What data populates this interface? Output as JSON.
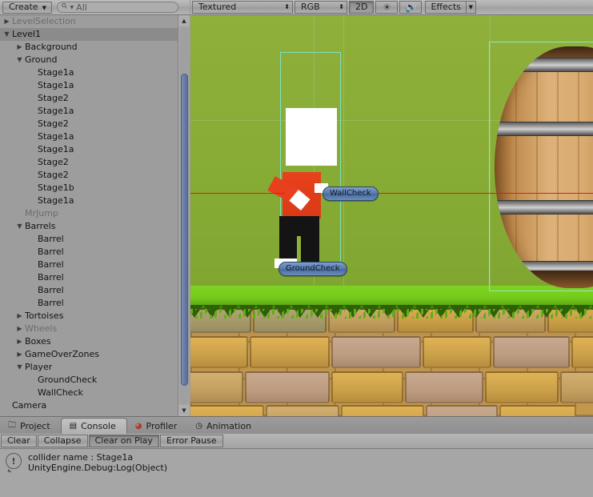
{
  "hierarchy": {
    "toolbar": {
      "create_label": "Create",
      "create_caret": "▼",
      "search_caret": "▼",
      "search_value": "All",
      "search_placeholder": "All"
    },
    "items": [
      {
        "label": "LevelSelection",
        "depth": 0,
        "arrow": "right",
        "active": false,
        "selected": false
      },
      {
        "label": "Level1",
        "depth": 0,
        "arrow": "down",
        "active": true,
        "selected": true
      },
      {
        "label": "Background",
        "depth": 1,
        "arrow": "right",
        "active": true,
        "selected": false
      },
      {
        "label": "Ground",
        "depth": 1,
        "arrow": "down",
        "active": true,
        "selected": false
      },
      {
        "label": "Stage1a",
        "depth": 2,
        "arrow": "none",
        "active": true,
        "selected": false
      },
      {
        "label": "Stage1a",
        "depth": 2,
        "arrow": "none",
        "active": true,
        "selected": false
      },
      {
        "label": "Stage2",
        "depth": 2,
        "arrow": "none",
        "active": true,
        "selected": false
      },
      {
        "label": "Stage1a",
        "depth": 2,
        "arrow": "none",
        "active": true,
        "selected": false
      },
      {
        "label": "Stage2",
        "depth": 2,
        "arrow": "none",
        "active": true,
        "selected": false
      },
      {
        "label": "Stage1a",
        "depth": 2,
        "arrow": "none",
        "active": true,
        "selected": false
      },
      {
        "label": "Stage1a",
        "depth": 2,
        "arrow": "none",
        "active": true,
        "selected": false
      },
      {
        "label": "Stage2",
        "depth": 2,
        "arrow": "none",
        "active": true,
        "selected": false
      },
      {
        "label": "Stage2",
        "depth": 2,
        "arrow": "none",
        "active": true,
        "selected": false
      },
      {
        "label": "Stage1b",
        "depth": 2,
        "arrow": "none",
        "active": true,
        "selected": false
      },
      {
        "label": "Stage1a",
        "depth": 2,
        "arrow": "none",
        "active": true,
        "selected": false
      },
      {
        "label": "MrJump",
        "depth": 1,
        "arrow": "none",
        "active": false,
        "selected": false
      },
      {
        "label": "Barrels",
        "depth": 1,
        "arrow": "down",
        "active": true,
        "selected": false
      },
      {
        "label": "Barrel",
        "depth": 2,
        "arrow": "none",
        "active": true,
        "selected": false
      },
      {
        "label": "Barrel",
        "depth": 2,
        "arrow": "none",
        "active": true,
        "selected": false
      },
      {
        "label": "Barrel",
        "depth": 2,
        "arrow": "none",
        "active": true,
        "selected": false
      },
      {
        "label": "Barrel",
        "depth": 2,
        "arrow": "none",
        "active": true,
        "selected": false
      },
      {
        "label": "Barrel",
        "depth": 2,
        "arrow": "none",
        "active": true,
        "selected": false
      },
      {
        "label": "Barrel",
        "depth": 2,
        "arrow": "none",
        "active": true,
        "selected": false
      },
      {
        "label": "Tortoises",
        "depth": 1,
        "arrow": "right",
        "active": true,
        "selected": false
      },
      {
        "label": "Wheels",
        "depth": 1,
        "arrow": "right",
        "active": false,
        "selected": false
      },
      {
        "label": "Boxes",
        "depth": 1,
        "arrow": "right",
        "active": true,
        "selected": false
      },
      {
        "label": "GameOverZones",
        "depth": 1,
        "arrow": "right",
        "active": true,
        "selected": false
      },
      {
        "label": "Player",
        "depth": 1,
        "arrow": "down",
        "active": true,
        "selected": false
      },
      {
        "label": "GroundCheck",
        "depth": 2,
        "arrow": "none",
        "active": true,
        "selected": false
      },
      {
        "label": "WallCheck",
        "depth": 2,
        "arrow": "none",
        "active": true,
        "selected": false
      },
      {
        "label": "Camera",
        "depth": 0,
        "arrow": "none",
        "active": true,
        "selected": false
      }
    ],
    "scrollbar": {
      "up_arrow": "▲",
      "down_arrow": "▼"
    }
  },
  "scene": {
    "toolbar": {
      "draw_mode": "Textured",
      "draw_mode_caret": "⬍",
      "color_mode": "RGB",
      "color_mode_caret": "⬍",
      "two_d_label": "2D",
      "lighting_icon": "light-icon",
      "audio_icon": "audio-icon",
      "effects_label": "Effects",
      "effects_caret": "▼"
    },
    "gizmos": [
      {
        "label": "WallCheck"
      },
      {
        "label": "GroundCheck"
      }
    ]
  },
  "bottom": {
    "tabs": [
      {
        "label": "Project",
        "icon": "folder-icon",
        "active": false
      },
      {
        "label": "Console",
        "icon": "console-icon",
        "active": true
      },
      {
        "label": "Profiler",
        "icon": "profiler-icon",
        "active": false
      },
      {
        "label": "Animation",
        "icon": "clock-icon",
        "active": false
      }
    ],
    "console_toolbar": [
      {
        "label": "Clear",
        "pressed": false
      },
      {
        "label": "Collapse",
        "pressed": false
      },
      {
        "label": "Clear on Play",
        "pressed": true
      },
      {
        "label": "Error Pause",
        "pressed": false
      }
    ],
    "log": {
      "icon": "log-info-icon",
      "icon_glyph": "!",
      "line1": "collider name : Stage1a",
      "line2": "UnityEngine.Debug:Log(Object)"
    }
  },
  "colors": {
    "chrome": "#a2a2a2",
    "panel": "#9d9d9d",
    "selection": "#8b8b8b",
    "scene_sky": "#86ab35",
    "grass": "#76cc1c",
    "dirt": "#c89c47",
    "player_red": "#e8401c",
    "gizmo_pill": "#5b7dae",
    "raycast_red": "#e01b1b",
    "select_outline": "#8fe8b9",
    "scrollbar_thumb": "#6a7ea8"
  }
}
